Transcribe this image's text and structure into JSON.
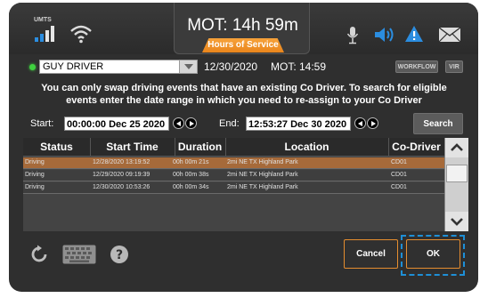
{
  "status_bar": {
    "signal_label": "UMTS",
    "mot_text": "MOT: 14h 59m",
    "hos_label": "Hours of Service"
  },
  "header": {
    "driver": "GUY DRIVER",
    "date": "12/30/2020",
    "mot": "MOT: 14:59",
    "workflow_label": "WORKFLOW",
    "vir_label": "VIR"
  },
  "message": "You can only swap driving events that have an existing Co Driver. To search for eligible events enter the date range in which you need to re-assign to your Co Driver",
  "range": {
    "start_label": "Start:",
    "start_value": "00:00:00 Dec 25 2020",
    "end_label": "End:",
    "end_value": "12:53:27 Dec 30 2020",
    "search_label": "Search"
  },
  "table": {
    "columns": [
      "Status",
      "Start Time",
      "Duration",
      "Location",
      "Co-Driver"
    ],
    "rows": [
      [
        "Driving",
        "12/28/2020 13:19:52",
        "00h 00m 21s",
        "2mi NE TX Highland Park",
        "CD01"
      ],
      [
        "Driving",
        "12/29/2020 09:19:39",
        "00h 00m 38s",
        "2mi NE TX Highland Park",
        "CD01"
      ],
      [
        "Driving",
        "12/30/2020 10:53:26",
        "00h 00m 34s",
        "2mi NE TX Highland Park",
        "CD01"
      ]
    ]
  },
  "footer": {
    "cancel_label": "Cancel",
    "ok_label": "OK"
  },
  "icons": [
    "signal-icon",
    "wifi-icon",
    "microphone-icon",
    "speaker-icon",
    "warning-icon",
    "mail-icon",
    "refresh-icon",
    "keyboard-icon",
    "help-icon",
    "scroll-up-icon",
    "scroll-down-icon"
  ],
  "colors": {
    "accent_orange": "#e9851c",
    "selection": "#a66a3a",
    "ok_focus": "#1e8fd6",
    "status_blue": "#2b8de0"
  }
}
